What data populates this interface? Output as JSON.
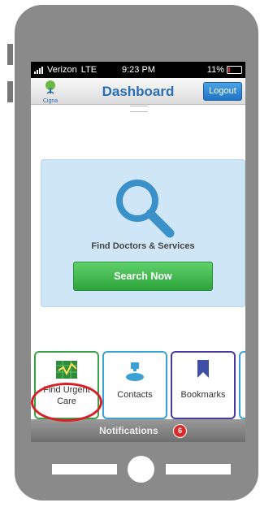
{
  "status": {
    "carrier": "Verizon",
    "network": "LTE",
    "time": "9:23 PM",
    "battery": "11%"
  },
  "header": {
    "logo_text": "Cigna",
    "title": "Dashboard",
    "logout_label": "Logout"
  },
  "search_card": {
    "label": "Find Doctors & Services",
    "button_label": "Search Now"
  },
  "tiles": [
    {
      "label_line1": "Find Urgent",
      "label_line2": "Care",
      "icon": "map-icon"
    },
    {
      "label": "Contacts",
      "icon": "contacts-icon"
    },
    {
      "label": "Bookmarks",
      "icon": "bookmark-icon"
    }
  ],
  "notifications": {
    "label": "Notifications",
    "count": "6"
  },
  "colors": {
    "accent": "#2a6fb3",
    "button_green": "#2ea43d",
    "badge_red": "#d92b2b",
    "highlight": "#d81f26"
  }
}
